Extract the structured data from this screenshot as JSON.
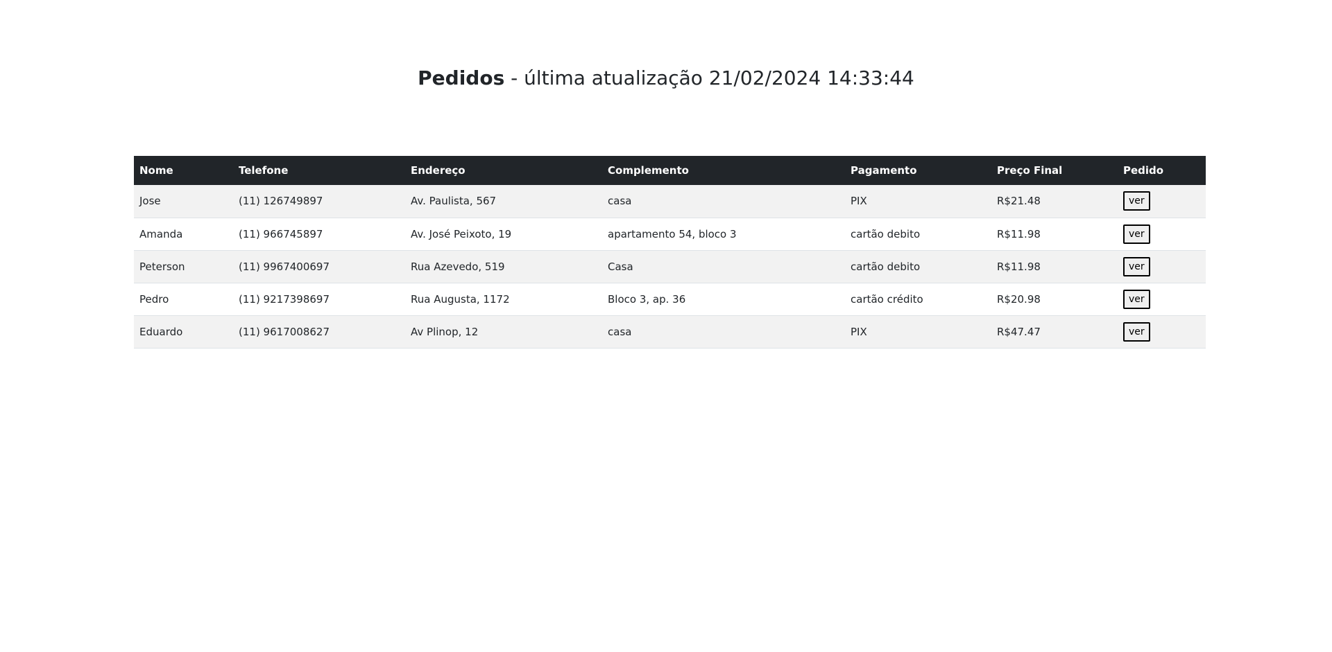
{
  "header": {
    "title": "Pedidos",
    "separator": " - ",
    "subtitle": "última atualização 21/02/2024 14:33:44"
  },
  "table": {
    "columns": [
      "Nome",
      "Telefone",
      "Endereço",
      "Complemento",
      "Pagamento",
      "Preço Final",
      "Pedido"
    ],
    "rows": [
      {
        "nome": "Jose",
        "telefone": "(11) 126749897",
        "endereco": "Av. Paulista, 567",
        "complemento": "casa",
        "pagamento": "PIX",
        "preco": "R$21.48",
        "acao": "ver"
      },
      {
        "nome": "Amanda",
        "telefone": "(11) 966745897",
        "endereco": "Av. José Peixoto, 19",
        "complemento": "apartamento 54, bloco 3",
        "pagamento": "cartão debito",
        "preco": "R$11.98",
        "acao": "ver"
      },
      {
        "nome": "Peterson",
        "telefone": "(11) 9967400697",
        "endereco": "Rua Azevedo, 519",
        "complemento": "Casa",
        "pagamento": "cartão debito",
        "preco": "R$11.98",
        "acao": "ver"
      },
      {
        "nome": "Pedro",
        "telefone": "(11) 9217398697",
        "endereco": "Rua Augusta, 1172",
        "complemento": "Bloco 3, ap. 36",
        "pagamento": "cartão crédito",
        "preco": "R$20.98",
        "acao": "ver"
      },
      {
        "nome": "Eduardo",
        "telefone": "(11) 9617008627",
        "endereco": "Av Plinop, 12",
        "complemento": "casa",
        "pagamento": "PIX",
        "preco": "R$47.47",
        "acao": "ver"
      }
    ]
  }
}
